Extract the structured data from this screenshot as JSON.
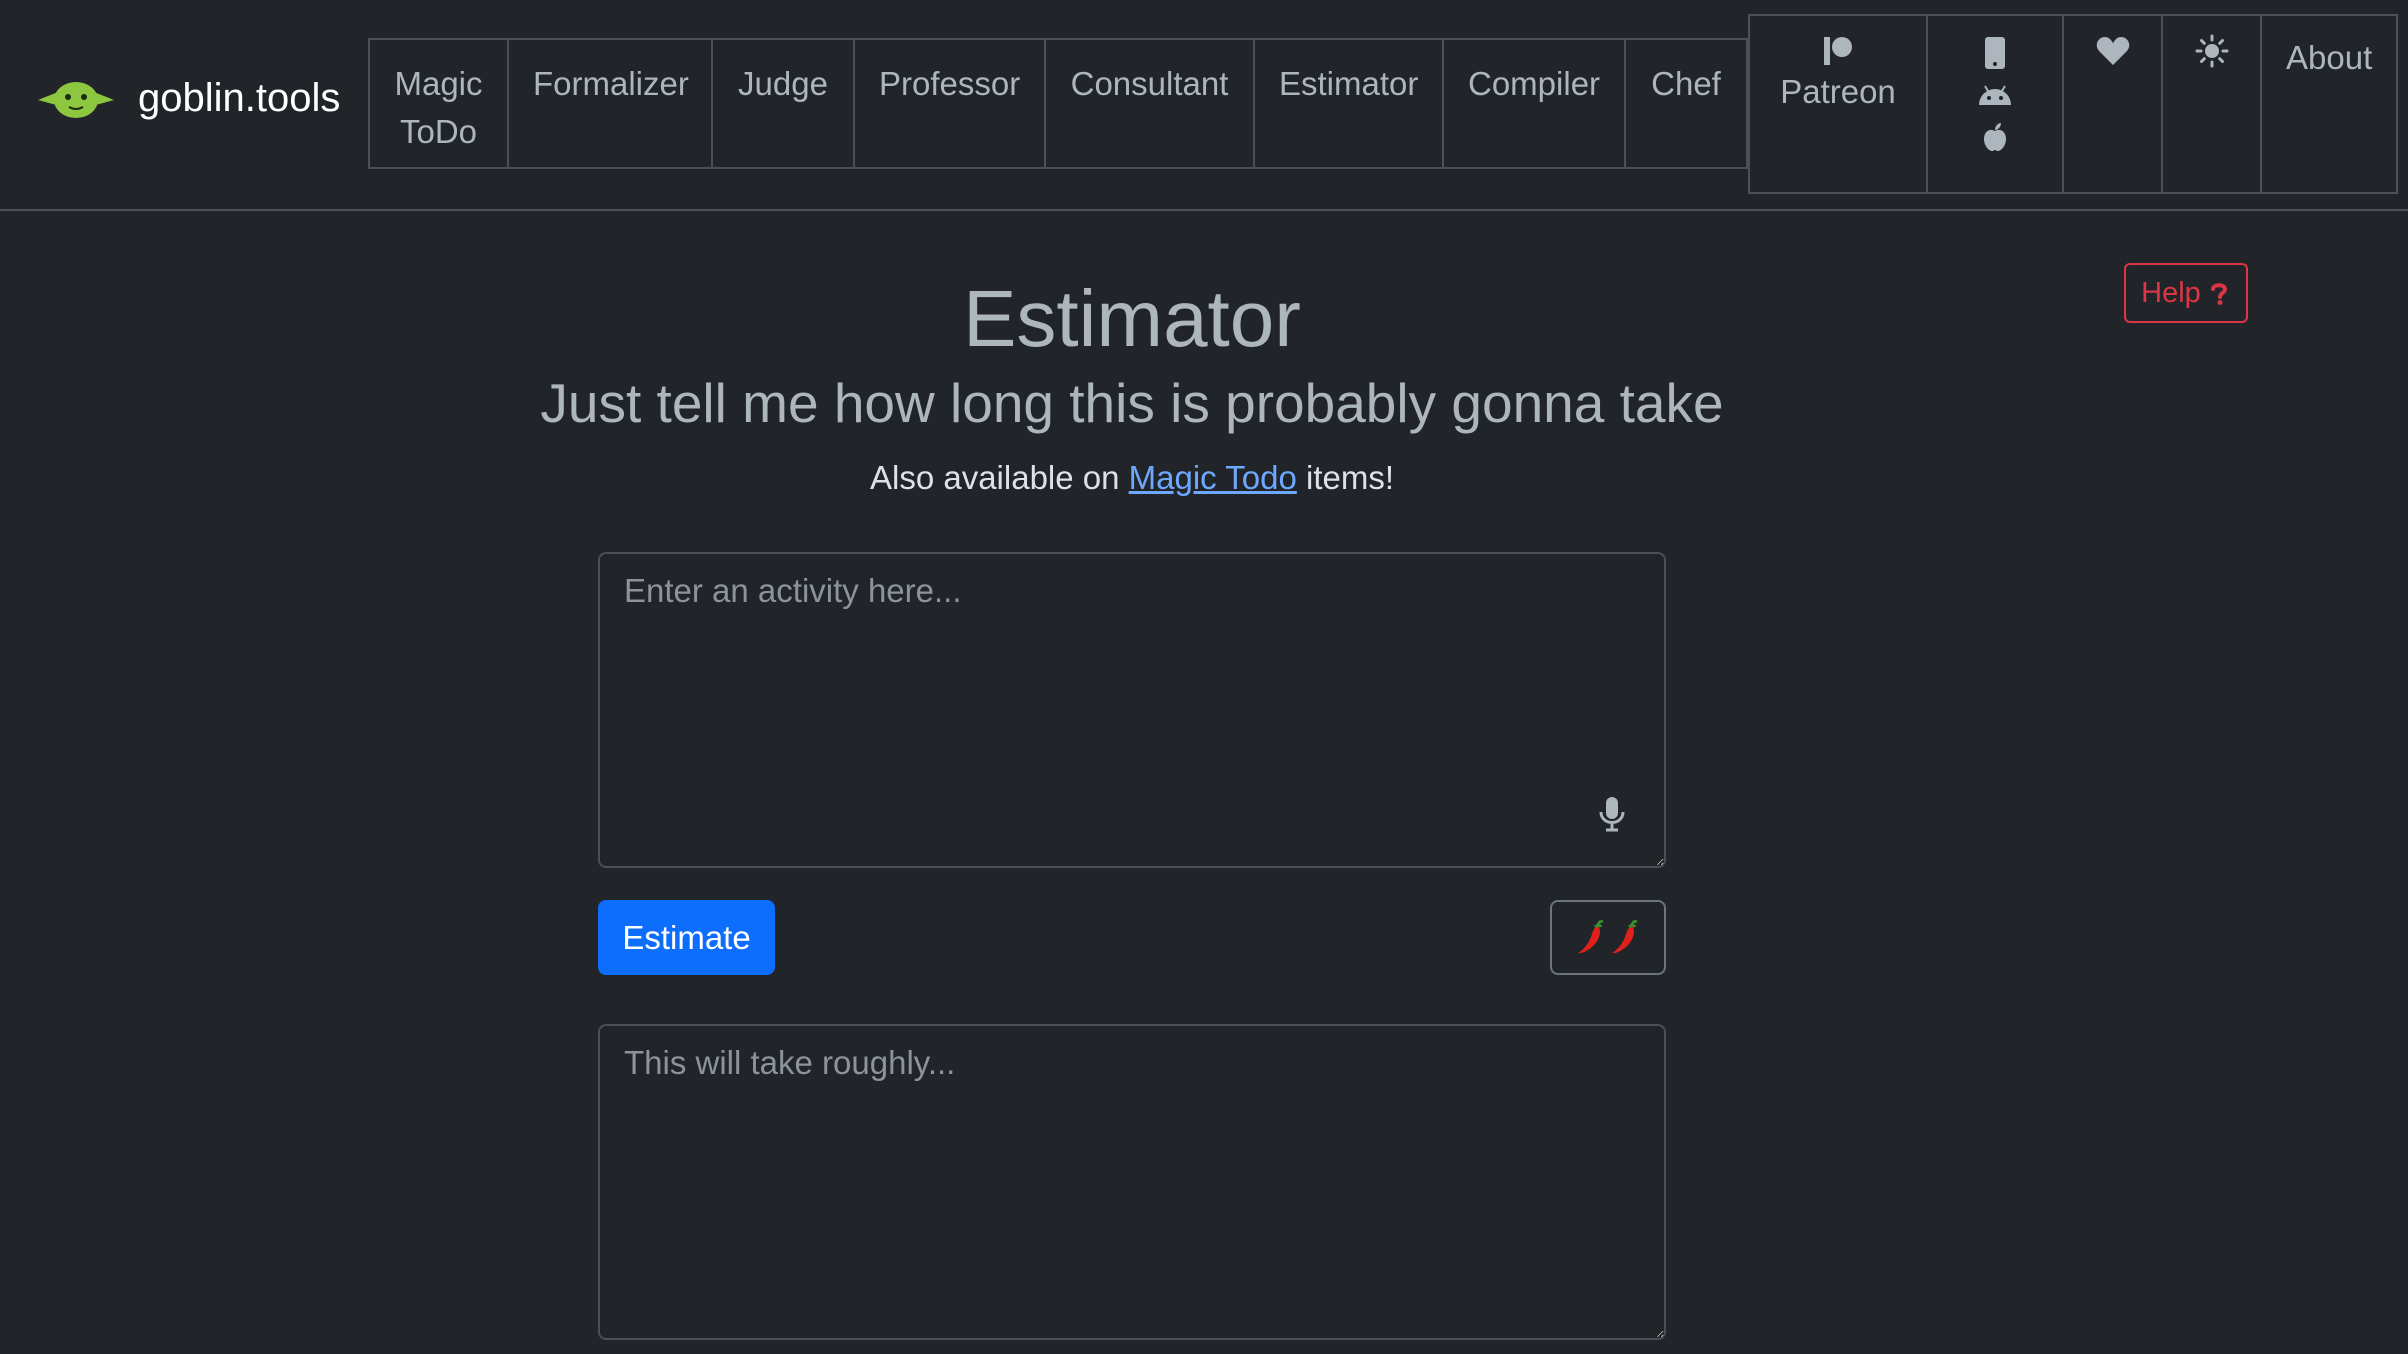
{
  "brand": {
    "name": "goblin.tools",
    "logo_icon": "goblin-logo-icon",
    "logo_color": "#8dc63f"
  },
  "nav": {
    "items": [
      {
        "label_line1": "Magic",
        "label_line2": "ToDo"
      },
      {
        "label_line1": "Formalizer",
        "label_line2": ""
      },
      {
        "label_line1": "Judge",
        "label_line2": ""
      },
      {
        "label_line1": "Professor",
        "label_line2": ""
      },
      {
        "label_line1": "Consultant",
        "label_line2": ""
      },
      {
        "label_line1": "Estimator",
        "label_line2": ""
      },
      {
        "label_line1": "Compiler",
        "label_line2": ""
      },
      {
        "label_line1": "Chef",
        "label_line2": ""
      }
    ],
    "patreon": {
      "label": "Patreon",
      "icon": "patreon-icon"
    },
    "apps": {
      "icons": [
        "mobile-phone-icon",
        "android-icon",
        "apple-icon"
      ]
    },
    "donate": {
      "icon": "heart-icon"
    },
    "theme": {
      "icon": "sun-icon"
    },
    "about": {
      "label": "About"
    }
  },
  "page": {
    "title": "Estimator",
    "subtitle": "Just tell me how long this is probably gonna take",
    "also_prefix": "Also available on",
    "also_link": "Magic Todo",
    "also_suffix": "items!",
    "help": {
      "label": "Help",
      "icon": "question-icon",
      "color": "#dc3545"
    }
  },
  "form": {
    "activity_placeholder": "Enter an activity here...",
    "activity_value": "",
    "mic_icon": "microphone-icon",
    "estimate_label": "Estimate",
    "spiciness_icon": "chili-pepper-icon",
    "spiciness_level": 2,
    "result_placeholder": "This will take roughly...",
    "result_value": ""
  },
  "colors": {
    "background": "#212529",
    "primary": "#0d6efd",
    "link": "#6ea8fe",
    "border": "#495057"
  }
}
